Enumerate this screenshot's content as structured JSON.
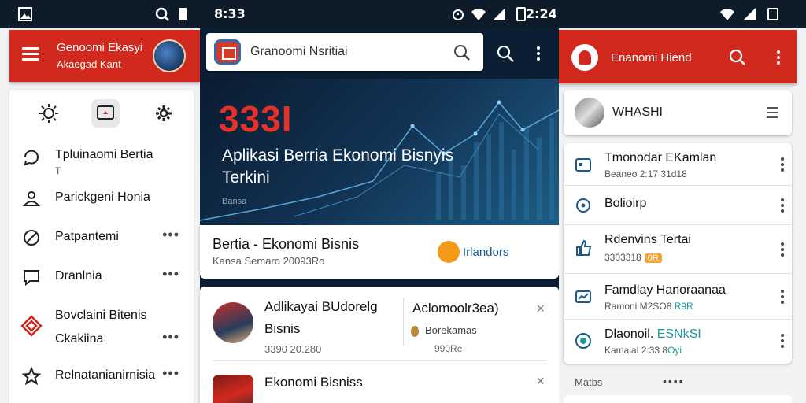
{
  "status": {
    "time_mid": "8:33",
    "time_right": "2:24",
    "icons": [
      "gallery-icon",
      "zoom-icon",
      "battery-icon",
      "alarm-icon",
      "wifi-icon",
      "signal-icon",
      "battery-icon"
    ]
  },
  "left": {
    "appbar": {
      "title": "Genoomi Ekasyi",
      "subtitle": "Akaegad Kant"
    },
    "drawer_icons": [
      "sun-icon",
      "news-icon",
      "gear-icon"
    ],
    "items": [
      {
        "label": "Tpluinaomi Bertia",
        "sub": "T",
        "icon": "chat-icon"
      },
      {
        "label": "Parickgeni Honia",
        "icon": "person-icon"
      },
      {
        "label": "Patpantemi",
        "icon": "leaf-icon",
        "more": "•••"
      },
      {
        "label": "Dranlnia",
        "icon": "message-icon",
        "more": "•••"
      },
      {
        "label": "Bovclaini Bitenis",
        "label2": "Ckakiina",
        "icon": "diamond-icon",
        "more": "•••"
      },
      {
        "label": "Relnatanianirnisia",
        "icon": "star-icon",
        "more": "•••"
      }
    ]
  },
  "mid": {
    "search": {
      "text": "Granoomi Nsritiai"
    },
    "hero": {
      "number": "333I",
      "title": "Aplikasi Berria Ekonomi Bisnyis Terkini",
      "small": "Bansa"
    },
    "headline": {
      "title": "Bertia - Ekonomi Bisnis",
      "sub": "Kansa Semaro 20093Ro",
      "more": "Irlandors"
    },
    "news": [
      {
        "title": "Adlikayai BUdorelg",
        "title2": "Bisnis",
        "date": "3390 20.280",
        "right_title": "Aclomoolr3ea)",
        "right_sub": "Borekamas",
        "right_date": "990Re",
        "close": "×"
      },
      {
        "title": "Ekonomi Bisniss",
        "close": "×"
      }
    ]
  },
  "right": {
    "appbar": {
      "title": "Enanomi Hiend"
    },
    "profile": {
      "name": "WHASHI"
    },
    "items": [
      {
        "title": "Tmonodar EKamlan",
        "sub": "Beaneo 2:17 31d18",
        "icon": "calendar-icon"
      },
      {
        "title": "Bolioirp",
        "icon": "target-icon"
      },
      {
        "title": "Rdenvins Tertai",
        "sub": "3303318",
        "tag": "0R",
        "icon": "thumb-icon"
      },
      {
        "title": "Famdlay Hanoraanaa",
        "sub": "Ramoni M2SO8 ",
        "teal": "R9R",
        "icon": "chart-icon"
      },
      {
        "title": "Dlaonoil.",
        "title_teal": "ESNkSI",
        "sub": "Kamaial 2:33 8",
        "teal": "Oyi",
        "icon": "globe-icon"
      }
    ],
    "footer": {
      "label": "Matbs",
      "dots": "••••"
    }
  },
  "colors": {
    "accent": "#d2291f",
    "statusbar": "#0e1c2a",
    "hero_number": "#e2322a"
  }
}
